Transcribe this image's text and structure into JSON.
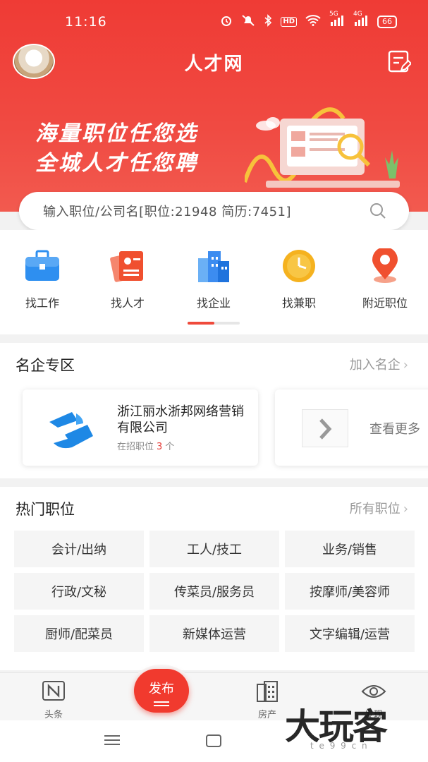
{
  "status_bar": {
    "time": "11:16",
    "net_5g": "5G",
    "net_4g": "4G",
    "hd": "HD",
    "battery": "66"
  },
  "nav": {
    "title": "人才网"
  },
  "banner": {
    "line1": "海量职位任您选",
    "line2": "全城人才任您聘"
  },
  "search": {
    "placeholder": "输入职位/公司名[职位:21948 简历:7451]"
  },
  "quick_nav": [
    {
      "label": "找工作",
      "icon": "briefcase-icon",
      "color": "#2e8ff0"
    },
    {
      "label": "找人才",
      "icon": "resume-icon",
      "color": "#f0502f"
    },
    {
      "label": "找企业",
      "icon": "building-icon",
      "color": "#3c8cf0"
    },
    {
      "label": "找兼职",
      "icon": "clock-icon",
      "color": "#f5b21f"
    },
    {
      "label": "附近职位",
      "icon": "location-pin-icon",
      "color": "#f0502f"
    }
  ],
  "famous": {
    "title": "名企专区",
    "more": "加入名企",
    "company_name": "浙江丽水浙邦网络营销有限公司",
    "jobs_prefix": "在招职位",
    "jobs_count": "3",
    "jobs_unit": "个",
    "view_more": "查看更多"
  },
  "hot": {
    "title": "热门职位",
    "more": "所有职位",
    "jobs": [
      "会计/出纳",
      "工人/技工",
      "业务/销售",
      "行政/文秘",
      "传菜员/服务员",
      "按摩师/美容师",
      "厨师/配菜员",
      "新媒体运营",
      "文字编辑/运营"
    ]
  },
  "tabbar": {
    "tab1": "头条",
    "publish": "发布",
    "tab3": "房产",
    "tab4": "发现"
  },
  "watermark": {
    "text": "大玩客",
    "sub": "t   e   9   9   c   n"
  },
  "colors": {
    "primary_red": "#ef3b35",
    "accent_count": "#e53935"
  }
}
